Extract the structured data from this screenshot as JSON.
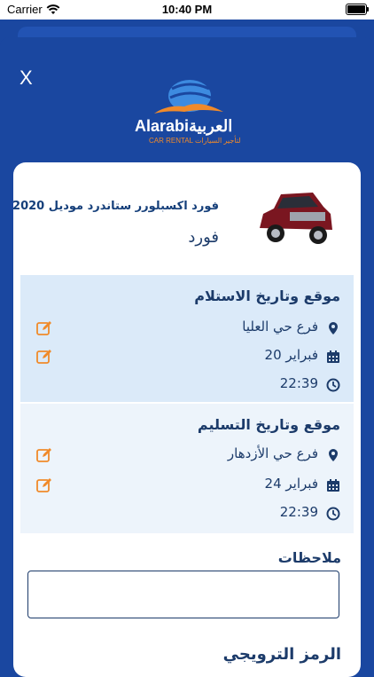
{
  "status_bar": {
    "carrier": "Carrier",
    "time": "10:40 PM"
  },
  "header": {
    "close_label": "X",
    "logo_text": "Alarabiالعربية",
    "logo_sub": "CAR RENTAL  لتأجير السيارات"
  },
  "car": {
    "model": "فورد اكسبلورر ستاندرد موديل 2020",
    "brand": "فورد"
  },
  "pickup": {
    "title": "موقع وتاريخ الاستلام",
    "location": "فرع حي العليا",
    "date": "20 فبراير",
    "time": "22:39"
  },
  "dropoff": {
    "title": "موقع وتاريخ التسليم",
    "location": "فرع حي الأزدهار",
    "date": "24 فبراير",
    "time": "22:39"
  },
  "notes": {
    "title": "ملاحظات",
    "value": ""
  },
  "promo": {
    "title": "الرمز الترويجي"
  },
  "colors": {
    "brand_blue": "#1a47a0",
    "accent_orange": "#f08a2a",
    "text_navy": "#1c3b6a"
  }
}
